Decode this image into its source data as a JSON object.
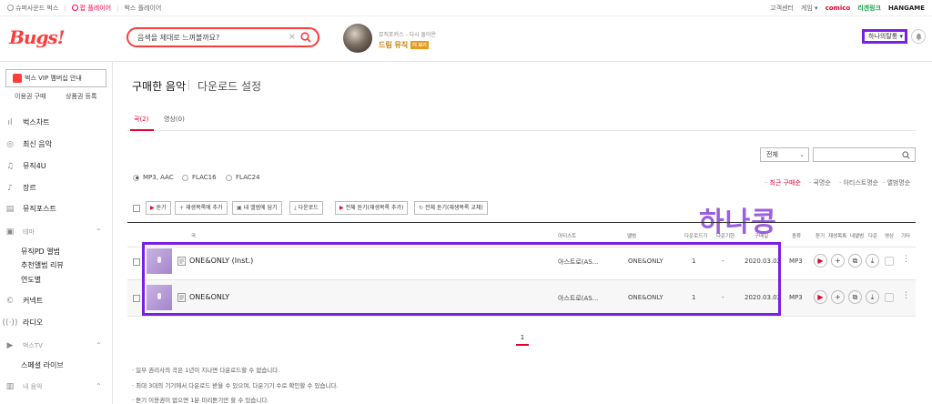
{
  "topbar": {
    "links": [
      "슈퍼사운드 벅스",
      "팝 플레이어",
      "벅스 플레이어"
    ],
    "right_links": [
      "고객센터",
      "게임"
    ],
    "brands": [
      "comico",
      "리겐링크",
      "HANGAME"
    ]
  },
  "header": {
    "logo": "Bugs!",
    "search_value": "음색을 제대로 느껴볼까요?",
    "promo_sub": "뮤직포커스 - 다시 돌아온",
    "promo_main": "드림 뮤직",
    "promo_badge": "더 보기",
    "user_name": "하나의탈퉁"
  },
  "sidebar": {
    "vip_label": "벅스 VIP 멤버십 안내",
    "ticket_buy": "이용권 구매",
    "ticket_register": "상품권 등록",
    "items": [
      "벅스차트",
      "최신 음악",
      "뮤직4U",
      "장르",
      "뮤직포스트"
    ],
    "theme_label": "테마",
    "theme_items": [
      "뮤직PD 앨범",
      "추천앨범 리뷰",
      "연도별"
    ],
    "more_items": [
      "커넥트",
      "라디오"
    ],
    "tv_label": "벅스TV",
    "tv_items": [
      "스페셜 라이브"
    ],
    "my_label": "내 음악"
  },
  "main": {
    "title": "구매한 음악",
    "title2": "다운로드 설정",
    "tabs": [
      "곡(2)",
      "영상(0)"
    ],
    "filter_select": "전체",
    "formats": [
      "MP3, AAC",
      "FLAC16",
      "FLAC24"
    ],
    "sorts": [
      "최근 구매순",
      "곡명순",
      "아티스트명순",
      "앨범명순"
    ],
    "toolbar": [
      "듣기",
      "재생목록에 추가",
      "내 앨범에 담기",
      "다운로드",
      "전체 듣기(재생목록 추가)",
      "전체 듣기(재생목록 교체)"
    ],
    "watermark": "하나콩",
    "columns": {
      "song": "곡",
      "artist": "아티스트",
      "album": "앨범",
      "downloads": "다운로드기",
      "limit": "다운기한",
      "date": "구매일",
      "type": "종류",
      "actions": [
        "듣기",
        "재생목록",
        "내앨범",
        "다운",
        "영상",
        "기타"
      ]
    },
    "rows": [
      {
        "title": "ONE&ONLY (Inst.)",
        "artist": "아스트로(AS...",
        "album": "ONE&ONLY",
        "downloads": "1",
        "limit": "-",
        "date": "2020.03.02",
        "type": "MP3"
      },
      {
        "title": "ONE&ONLY",
        "artist": "아스트로(AS...",
        "album": "ONE&ONLY",
        "downloads": "1",
        "limit": "-",
        "date": "2020.03.02",
        "type": "MP3"
      }
    ],
    "page": "1",
    "notes": [
      "· 일부 권리사의 곡은 1년이 지나면 다운로드할 수 없습니다.",
      "· 최대 3대의 기기에서 다운로드 받을 수 있으며, 다운기기 수로 확인할 수 있습니다.",
      "· 듣기 이용권이 없으면 1분 미리듣기만 할 수 있습니다."
    ]
  }
}
